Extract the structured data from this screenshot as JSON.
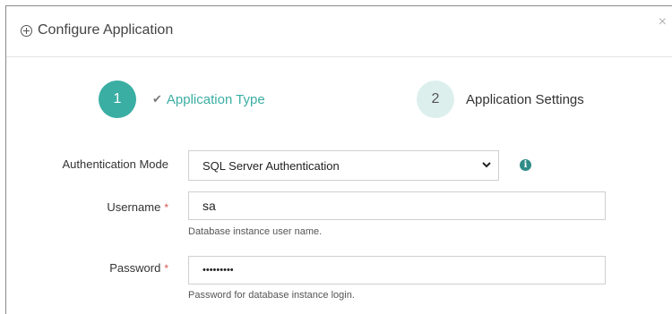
{
  "dialog": {
    "title": "Configure Application",
    "close_symbol": "×",
    "icon": "plus-circle-icon"
  },
  "steps": [
    {
      "number": "1",
      "label": "Application Type",
      "state": "completed",
      "check": "✔"
    },
    {
      "number": "2",
      "label": "Application Settings",
      "state": "pending"
    }
  ],
  "form": {
    "auth_mode": {
      "label": "Authentication Mode",
      "value": "SQL Server Authentication",
      "info_icon": "i"
    },
    "username": {
      "label": "Username",
      "required_mark": "*",
      "value": "sa",
      "help": "Database instance user name."
    },
    "password": {
      "label": "Password",
      "required_mark": "*",
      "value": "•••••••••",
      "help": "Password for database instance login."
    }
  },
  "colors": {
    "accent": "#3aaea3",
    "accent_light": "#dcefed",
    "required": "#d9534f",
    "info": "#2e8b88"
  }
}
